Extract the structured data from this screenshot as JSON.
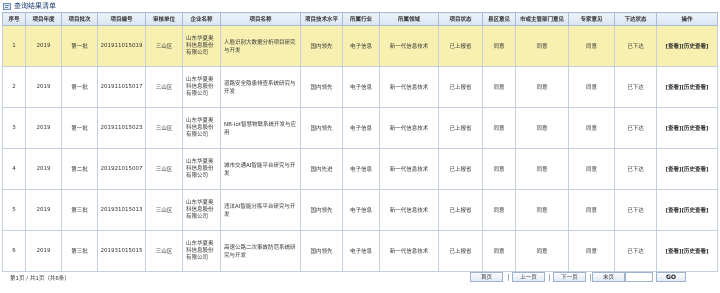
{
  "title": "查询结果清单",
  "columns": [
    "序号",
    "项目年度",
    "项目批次",
    "项目编号",
    "审核单位",
    "企业名称",
    "项目名称",
    "项目技术水平",
    "所属行业",
    "所属领域",
    "项目状态",
    "县区意见",
    "市或主管部门意见",
    "专家意见",
    "下达状态",
    "操作"
  ],
  "rows": [
    {
      "no": "1",
      "year": "2019",
      "batch": "第一批",
      "code": "201911015019",
      "unit": "三山区",
      "company": "山东华夏奥科信息股份有限公司",
      "project": "人脸识别大数据分析项目研究与开发",
      "level": "国内领先",
      "industry": "电子信息",
      "field": "新一代信息技术",
      "status": "已上报省",
      "county": "同意",
      "city": "同意",
      "expert": "同意",
      "release": "已下达",
      "op_view": "[查看]",
      "op_history": "[历史查看]"
    },
    {
      "no": "2",
      "year": "2019",
      "batch": "第一批",
      "code": "201911015017",
      "unit": "三山区",
      "company": "山东华夏奥科信息股份有限公司",
      "project": "道路安全隐患排查系统研究与开发",
      "level": "国内领先",
      "industry": "电子信息",
      "field": "新一代信息技术",
      "status": "已上报省",
      "county": "同意",
      "city": "同意",
      "expert": "同意",
      "release": "已下达",
      "op_view": "[查看]",
      "op_history": "[历史查看]"
    },
    {
      "no": "3",
      "year": "2019",
      "batch": "第一批",
      "code": "201911015023",
      "unit": "三山区",
      "company": "山东华夏奥科信息股份有限公司",
      "project": "NB-Iot智慧物联系统开发与应用",
      "level": "国内领先",
      "industry": "电子信息",
      "field": "新一代信息技术",
      "status": "已上报省",
      "county": "同意",
      "city": "同意",
      "expert": "同意",
      "release": "已下达",
      "op_view": "[查看]",
      "op_history": "[历史查看]"
    },
    {
      "no": "4",
      "year": "2019",
      "batch": "第二批",
      "code": "201921015007",
      "unit": "三山区",
      "company": "山东华夏奥科信息股份有限公司",
      "project": "城市交通AI智能平台研究与开发",
      "level": "国内先进",
      "industry": "电子信息",
      "field": "新一代信息技术",
      "status": "已上报省",
      "county": "同意",
      "city": "同意",
      "expert": "同意",
      "release": "已下达",
      "op_view": "[查看]",
      "op_history": "[历史查看]"
    },
    {
      "no": "5",
      "year": "2019",
      "batch": "第三批",
      "code": "201931015013",
      "unit": "三山区",
      "company": "山东华夏奥科信息股份有限公司",
      "project": "违法AI智能分拣平台研究与开发",
      "level": "国内领先",
      "industry": "电子信息",
      "field": "新一代信息技术",
      "status": "已上报省",
      "county": "同意",
      "city": "同意",
      "expert": "同意",
      "release": "已下达",
      "op_view": "[查看]",
      "op_history": "[历史查看]"
    },
    {
      "no": "6",
      "year": "2019",
      "batch": "第三批",
      "code": "201931015015",
      "unit": "三山区",
      "company": "山东华夏奥科信息股份有限公司",
      "project": "高速公路二次事故防范系统研究与开发",
      "level": "国内领先",
      "industry": "电子信息",
      "field": "新一代信息技术",
      "status": "已上报省",
      "county": "同意",
      "city": "同意",
      "expert": "同意",
      "release": "已下达",
      "op_view": "[查看]",
      "op_history": "[历史查看]"
    }
  ],
  "pagination": {
    "info": "第1页 / 共1页（共6条）",
    "first": "首页",
    "prev": "上一页",
    "next": "下一页",
    "last": "末页",
    "go": "GO"
  }
}
